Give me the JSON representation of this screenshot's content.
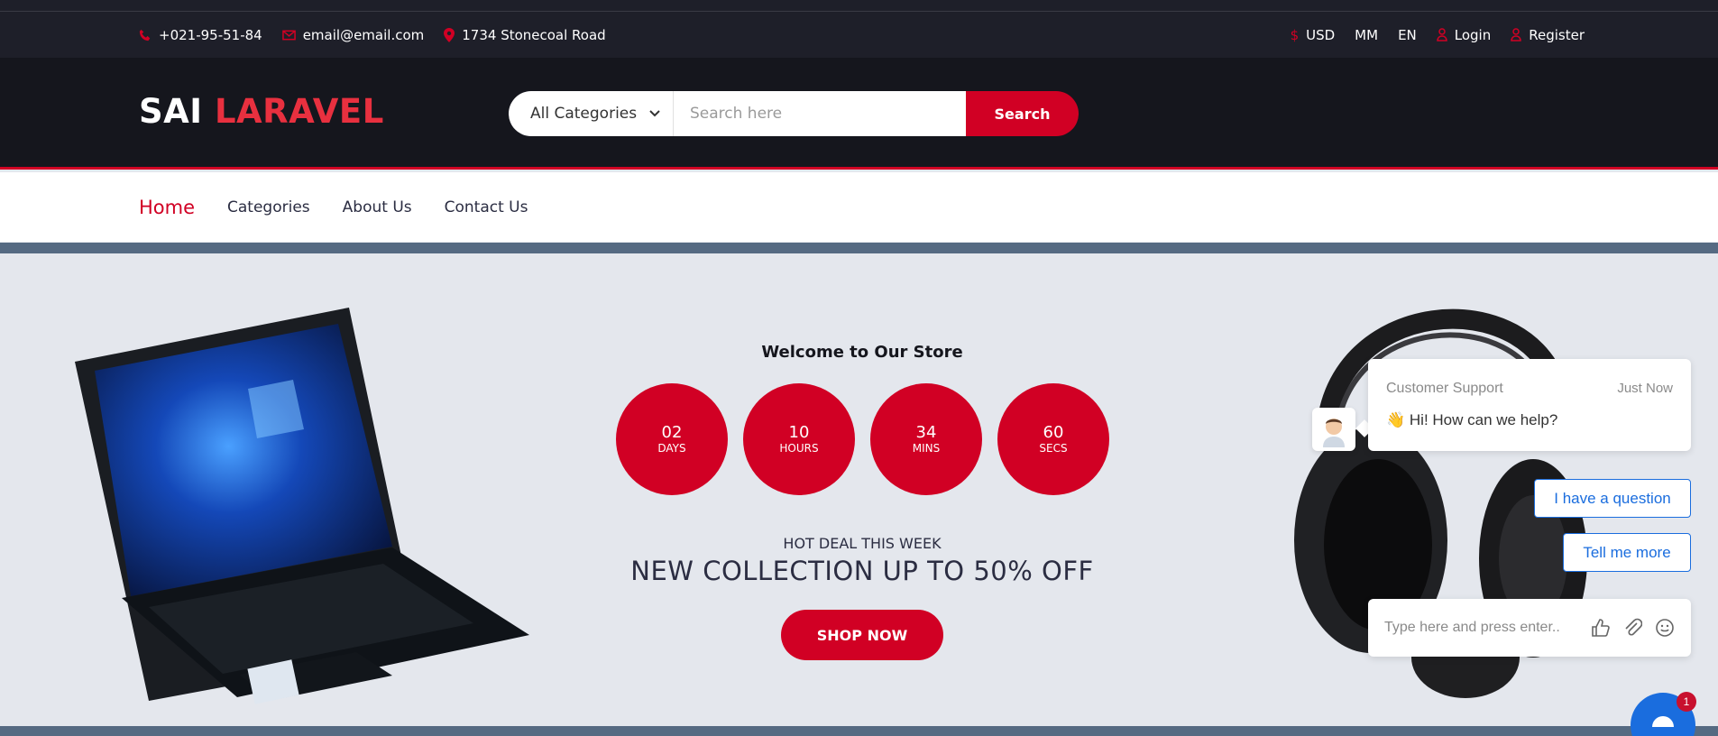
{
  "topbar": {
    "phone": "+021-95-51-84",
    "email": "email@email.com",
    "address": "1734 Stonecoal Road",
    "currency": "USD",
    "mm": "MM",
    "language": "EN",
    "login": "Login",
    "register": "Register"
  },
  "header": {
    "logo_part1": "SAI",
    "logo_part2": "LARAVEL",
    "category_select": "All Categories",
    "search_placeholder": "Search here",
    "search_button": "Search"
  },
  "nav": {
    "items": [
      {
        "label": "Home"
      },
      {
        "label": "Categories"
      },
      {
        "label": "About Us"
      },
      {
        "label": "Contact Us"
      }
    ]
  },
  "hero": {
    "welcome": "Welcome to Our Store",
    "countdown": [
      {
        "value": "02",
        "unit": "DAYS"
      },
      {
        "value": "10",
        "unit": "HOURS"
      },
      {
        "value": "34",
        "unit": "MINS"
      },
      {
        "value": "60",
        "unit": "SECS"
      }
    ],
    "hot_deal": "HOT DEAL THIS WEEK",
    "collection": "NEW COLLECTION UP TO 50% OFF",
    "shop_button": "SHOP NOW"
  },
  "chat": {
    "title": "Customer Support",
    "time": "Just Now",
    "message": "👋 Hi! How can we help?",
    "quick_replies": [
      "I have a question",
      "Tell me more"
    ],
    "input_placeholder": "Type here and press enter..",
    "badge_count": "1"
  },
  "colors": {
    "accent": "#d10024",
    "dark": "#15161d",
    "chat_blue": "#1a6dde"
  }
}
